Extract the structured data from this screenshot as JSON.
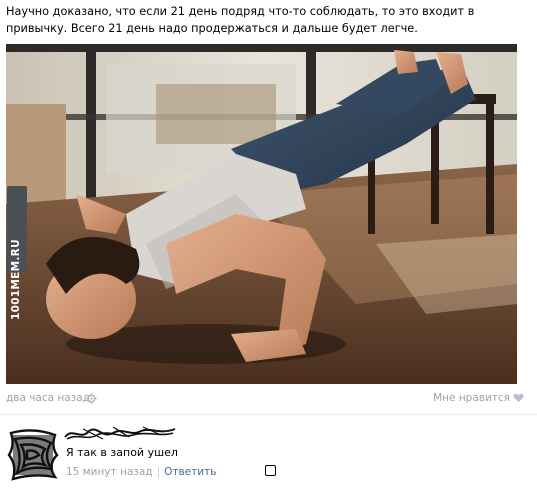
{
  "post": {
    "text": "Научно доказано, что если 21 день подряд что-то соблюдать, то это входит в привычку. Всего 21 день надо продержаться и дальше будет легче.",
    "watermark": "1001MEM.RU",
    "time": "два часа назад",
    "like_label": "Мне нравится"
  },
  "comment": {
    "text": "Я так в запой ушел",
    "time": "15 минут назад",
    "reply_label": "Ответить"
  },
  "icons": {
    "settings": "gear-icon",
    "like": "heart-icon"
  },
  "colors": {
    "meta_text": "#9aa4ad",
    "link": "#4b6c91"
  }
}
